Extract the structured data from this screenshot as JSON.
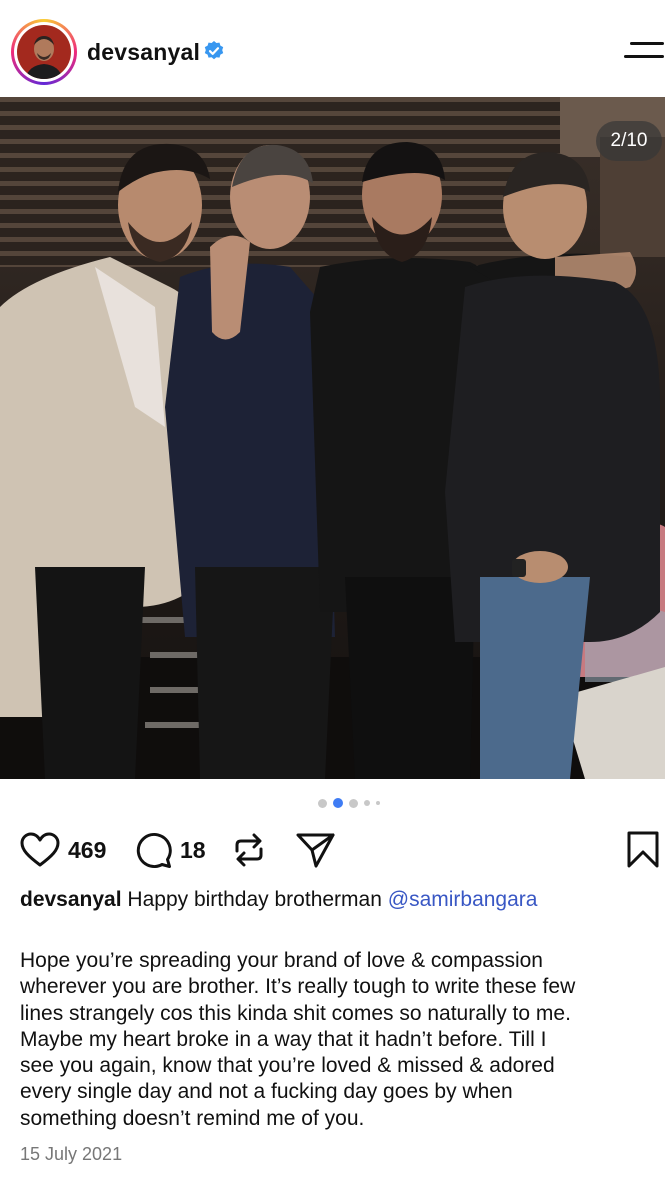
{
  "post": {
    "username": "devsanyal",
    "verified": true,
    "avatar_icon": "profile-avatar",
    "menu_icon": "hamburger-menu-icon",
    "photo_description_icon": "group-photo",
    "carousel": {
      "counter": "2/10",
      "current_index": 2,
      "total": 10
    },
    "stats": {
      "likes": "469",
      "comments": "18"
    },
    "caption": {
      "username": "devsanyal",
      "text": "Happy birthday brotherman",
      "mention": "@samirbangara"
    },
    "body_lines": [
      "Hope you’re spreading your brand of love & compassion",
      "wherever you are brother. It’s really tough to write these few",
      "lines strangely cos this kinda shit comes so naturally to me.",
      "Maybe my heart broke in a way that it hadn’t before. Till I",
      "see you again, know that you’re loved & missed & adored",
      "every single day and not a fucking day goes by when",
      "something doesn’t remind me of you."
    ],
    "date": "15 July 2021"
  },
  "colors": {
    "verified_blue": "#3897f0",
    "active_dot": "#3f7cf4",
    "mention": "#3957c4",
    "meta_text": "#777777"
  }
}
